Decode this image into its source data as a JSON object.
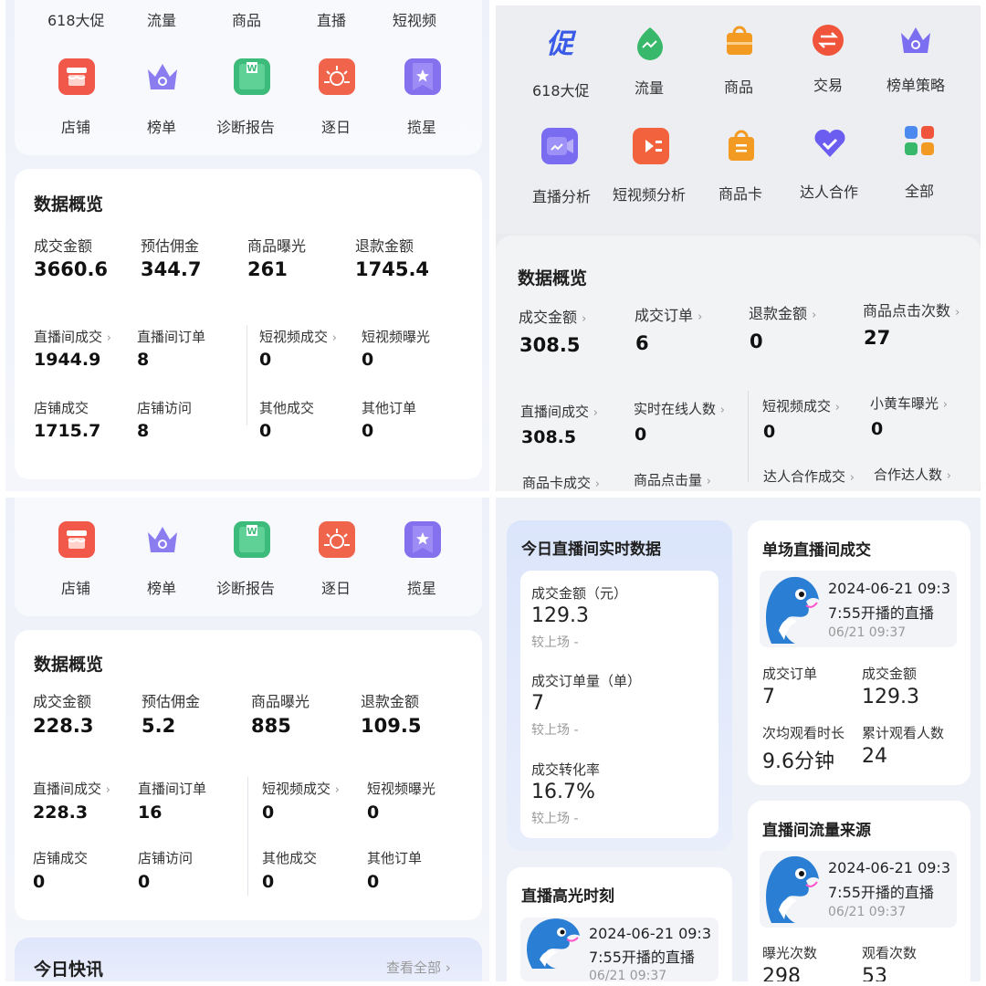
{
  "q1": {
    "top_row": [
      "618大促",
      "流量",
      "商品",
      "直播",
      "短视频"
    ],
    "icons": [
      {
        "label": "店铺",
        "icon": "shop-icon",
        "color": "#f1584a"
      },
      {
        "label": "榜单",
        "icon": "crown-icon",
        "color": "#8b7cf0"
      },
      {
        "label": "诊断报告",
        "icon": "report-icon",
        "color": "#3dbb7a"
      },
      {
        "label": "逐日",
        "icon": "sun-icon",
        "color": "#f0644b"
      },
      {
        "label": "揽星",
        "icon": "star-icon",
        "color": "#8571ee"
      }
    ],
    "overview": {
      "title": "数据概览",
      "main": [
        {
          "label": "成交金额",
          "value": "3660.6"
        },
        {
          "label": "预估佣金",
          "value": "344.7"
        },
        {
          "label": "商品曝光",
          "value": "261"
        },
        {
          "label": "退款金额",
          "value": "1745.4"
        }
      ],
      "grid": [
        {
          "label": "直播间成交",
          "value": "1944.9",
          "arrow": true
        },
        {
          "label": "直播间订单",
          "value": "8"
        },
        {
          "label": "短视频成交",
          "value": "0",
          "arrow": true
        },
        {
          "label": "短视频曝光",
          "value": "0"
        },
        {
          "label": "店铺成交",
          "value": "1715.7"
        },
        {
          "label": "店铺访问",
          "value": "8"
        },
        {
          "label": "其他成交",
          "value": "0"
        },
        {
          "label": "其他订单",
          "value": "0"
        }
      ]
    }
  },
  "q2": {
    "icons_row1": [
      {
        "label": "618大促",
        "icon": "promo-icon",
        "color": "#3a5be8"
      },
      {
        "label": "流量",
        "icon": "traffic-icon",
        "color": "#37b86b"
      },
      {
        "label": "商品",
        "icon": "bag-icon",
        "color": "#f39a23"
      },
      {
        "label": "交易",
        "icon": "exchange-icon",
        "color": "#f0553c"
      },
      {
        "label": "榜单策略",
        "icon": "crown-icon",
        "color": "#7c6ef0"
      }
    ],
    "icons_row2": [
      {
        "label": "直播分析",
        "icon": "live-icon",
        "color": "#7a6cf0"
      },
      {
        "label": "短视频分析",
        "icon": "video-icon",
        "color": "#f2633d"
      },
      {
        "label": "商品卡",
        "icon": "product-card-icon",
        "color": "#f39a23"
      },
      {
        "label": "达人合作",
        "icon": "heart-icon",
        "color": "#6a5df0"
      },
      {
        "label": "全部",
        "icon": "grid-icon",
        "color": "#4d8af0"
      }
    ],
    "overview": {
      "title": "数据概览",
      "row1": [
        {
          "label": "成交金额",
          "value": "308.5"
        },
        {
          "label": "成交订单",
          "value": "6"
        },
        {
          "label": "退款金额",
          "value": "0"
        },
        {
          "label": "商品点击次数",
          "value": "27"
        }
      ],
      "row2": [
        {
          "label": "直播间成交",
          "value": "308.5"
        },
        {
          "label": "实时在线人数",
          "value": "0"
        },
        {
          "label": "短视频成交",
          "value": "0"
        },
        {
          "label": "小黄车曝光",
          "value": "0"
        }
      ],
      "row3": [
        "商品卡成交",
        "商品点击量",
        "达人合作成交",
        "合作达人数"
      ]
    }
  },
  "q3": {
    "icons": [
      {
        "label": "店铺",
        "icon": "shop-icon",
        "color": "#f1584a"
      },
      {
        "label": "榜单",
        "icon": "crown-icon",
        "color": "#8b7cf0"
      },
      {
        "label": "诊断报告",
        "icon": "report-icon",
        "color": "#3dbb7a"
      },
      {
        "label": "逐日",
        "icon": "sun-icon",
        "color": "#f0644b"
      },
      {
        "label": "揽星",
        "icon": "star-icon",
        "color": "#8571ee"
      }
    ],
    "overview": {
      "title": "数据概览",
      "main": [
        {
          "label": "成交金额",
          "value": "228.3"
        },
        {
          "label": "预估佣金",
          "value": "5.2"
        },
        {
          "label": "商品曝光",
          "value": "885"
        },
        {
          "label": "退款金额",
          "value": "109.5"
        }
      ],
      "grid": [
        {
          "label": "直播间成交",
          "value": "228.3",
          "arrow": true
        },
        {
          "label": "直播间订单",
          "value": "16"
        },
        {
          "label": "短视频成交",
          "value": "0",
          "arrow": true
        },
        {
          "label": "短视频曝光",
          "value": "0"
        },
        {
          "label": "店铺成交",
          "value": "0"
        },
        {
          "label": "店铺访问",
          "value": "0"
        },
        {
          "label": "其他成交",
          "value": "0"
        },
        {
          "label": "其他订单",
          "value": "0"
        }
      ]
    },
    "news": {
      "title": "今日快讯",
      "link": "查看全部 ›"
    }
  },
  "q4": {
    "realtime": {
      "title": "今日直播间实时数据",
      "metrics": [
        {
          "label": "成交金额（元）",
          "value": "129.3",
          "compare": "较上场 -"
        },
        {
          "label": "成交订单量（单）",
          "value": "7",
          "compare": "较上场 -"
        },
        {
          "label": "成交转化率",
          "value": "16.7%",
          "compare": "较上场 -"
        }
      ]
    },
    "highlight": {
      "title": "直播高光时刻",
      "line1": "2024-06-21 09:3",
      "line2": "7:55开播的直播",
      "time": "06/21 09:37"
    },
    "single": {
      "title": "单场直播间成交",
      "line1": "2024-06-21 09:3",
      "line2": "7:55开播的直播",
      "time": "06/21 09:37",
      "stats": [
        {
          "label": "成交订单",
          "value": "7"
        },
        {
          "label": "成交金额",
          "value": "129.3"
        },
        {
          "label": "次均观看时长",
          "value": "9.6分钟"
        },
        {
          "label": "累计观看人数",
          "value": "24"
        }
      ]
    },
    "traffic": {
      "title": "直播间流量来源",
      "line1": "2024-06-21 09:3",
      "line2": "7:55开播的直播",
      "time": "06/21 09:37",
      "stats": [
        {
          "label": "曝光次数",
          "value": "298"
        },
        {
          "label": "观看次数",
          "value": "53"
        }
      ]
    }
  }
}
